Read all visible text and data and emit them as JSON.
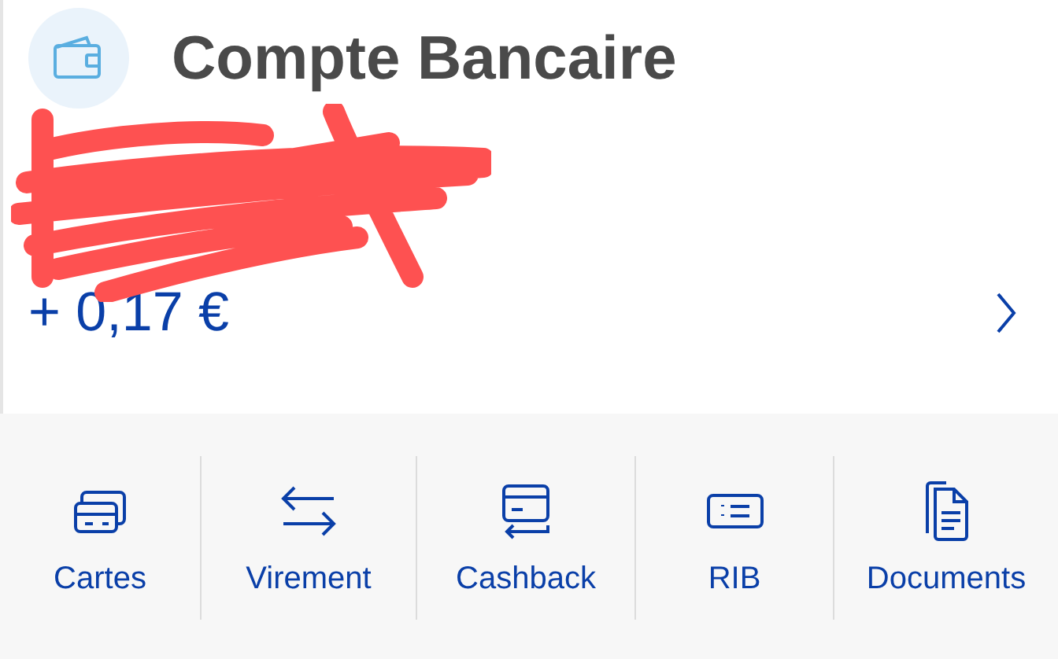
{
  "account": {
    "title": "Compte Bancaire",
    "amount": "+ 0,17 €"
  },
  "actions": [
    {
      "label": "Cartes"
    },
    {
      "label": "Virement"
    },
    {
      "label": "Cashback"
    },
    {
      "label": "RIB"
    },
    {
      "label": "Documents"
    }
  ]
}
